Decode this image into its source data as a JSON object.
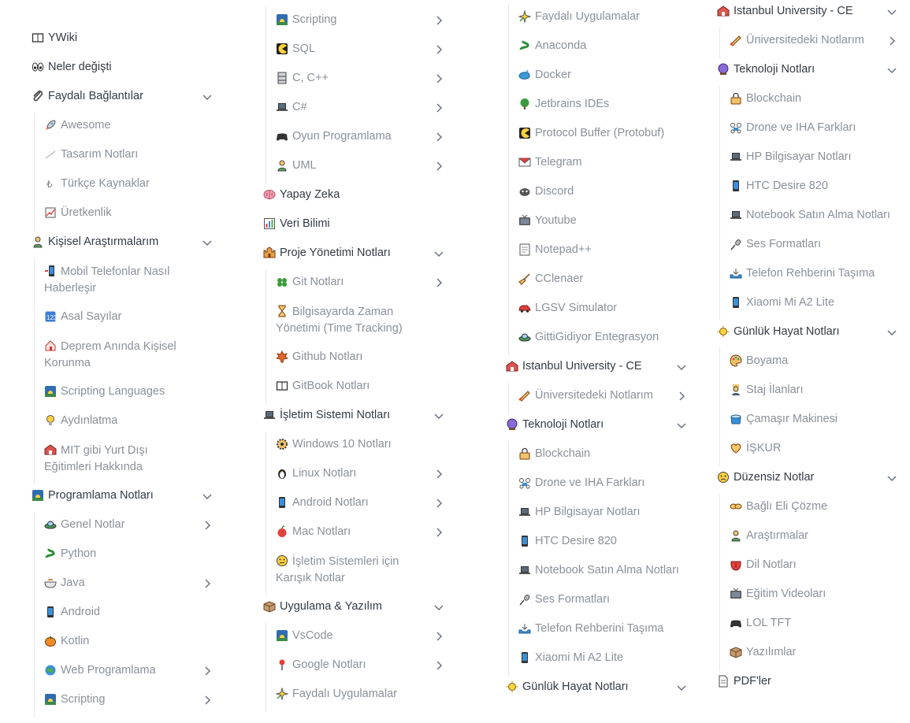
{
  "columns": [
    {
      "items": [
        {
          "label": "YWiki",
          "icon": "book-icon",
          "level": 0
        },
        {
          "label": "Neler değişti",
          "icon": "eyes-icon",
          "level": 0
        },
        {
          "label": "Faydalı Bağlantılar",
          "icon": "paperclip-icon",
          "level": 0,
          "expanded": true
        },
        {
          "label": "Awesome",
          "icon": "rocket-icon",
          "level": 1
        },
        {
          "label": "Tasarım Notları",
          "icon": "pencil-line-icon",
          "level": 1
        },
        {
          "label": "Türkçe Kaynaklar",
          "icon": "turkish-lira-icon",
          "level": 1
        },
        {
          "label": "Üretkenlik",
          "icon": "chart-increasing-icon",
          "level": 1
        },
        {
          "label": "Kişisel Araştırmalarım",
          "icon": "person-icon",
          "level": 0,
          "expanded": true
        },
        {
          "label": "Mobil Telefonlar Nasıl Haberleşir",
          "icon": "mobile-arrow-icon",
          "level": 1,
          "wrap": true
        },
        {
          "label": "Asal Sayılar",
          "icon": "numbers-icon",
          "level": 1
        },
        {
          "label": "Deprem Anında Kişisel Korunma",
          "icon": "house-icon",
          "level": 1,
          "wrap": true
        },
        {
          "label": "Scripting Languages",
          "icon": "sunrise-icon",
          "level": 1
        },
        {
          "label": "Aydınlatma",
          "icon": "lightbulb-icon",
          "level": 1
        },
        {
          "label": "MIT gibi Yurt Dışı Eğitimleri Hakkında",
          "icon": "school-icon",
          "level": 1,
          "wrap": true
        },
        {
          "label": "Programlama Notları",
          "icon": "sunrise-icon",
          "level": 0,
          "expanded": true
        },
        {
          "label": "Genel Notlar",
          "icon": "flying-saucer-icon",
          "level": 1,
          "has_children": true
        },
        {
          "label": "Python",
          "icon": "snake-icon",
          "level": 1
        },
        {
          "label": "Java",
          "icon": "bowl-icon",
          "level": 1,
          "has_children": true
        },
        {
          "label": "Android",
          "icon": "mobile-icon",
          "level": 1
        },
        {
          "label": "Kotlin",
          "icon": "pumpkin-icon",
          "level": 1
        },
        {
          "label": "Web Programlama",
          "icon": "globe-icon",
          "level": 1,
          "has_children": true
        },
        {
          "label": "Scripting",
          "icon": "sunrise-icon",
          "level": 1,
          "has_children": true
        }
      ]
    },
    {
      "items": [
        {
          "label": "Scripting",
          "icon": "sunrise-icon",
          "level": 1,
          "has_children": true
        },
        {
          "label": "SQL",
          "icon": "pacman-icon",
          "level": 1,
          "has_children": true
        },
        {
          "label": "C, C++",
          "icon": "file-cabinet-icon",
          "level": 1,
          "has_children": true
        },
        {
          "label": "C#",
          "icon": "laptop-icon",
          "level": 1,
          "has_children": true
        },
        {
          "label": "Oyun Programlama",
          "icon": "gamepad-icon",
          "level": 1,
          "has_children": true
        },
        {
          "label": "UML",
          "icon": "person-icon",
          "level": 1,
          "has_children": true
        },
        {
          "label": "Yapay Zeka",
          "icon": "brain-icon",
          "level": 0
        },
        {
          "label": "Veri Bilimi",
          "icon": "bar-chart-icon",
          "level": 0
        },
        {
          "label": "Proje Yönetimi Notları",
          "icon": "castle-icon",
          "level": 0,
          "expanded": true
        },
        {
          "label": "Git Notları",
          "icon": "clover-icon",
          "level": 1,
          "has_children": true
        },
        {
          "label": "Bilgisayarda Zaman Yönetimi (Time Tracking)",
          "icon": "hourglass-icon",
          "level": 1,
          "wrap": true
        },
        {
          "label": "Github Notları",
          "icon": "maple-leaf-icon",
          "level": 1
        },
        {
          "label": "GitBook Notları",
          "icon": "book-icon",
          "level": 1
        },
        {
          "label": "İşletim Sistemi Notları",
          "icon": "laptop-icon",
          "level": 0,
          "expanded": true
        },
        {
          "label": "Windows 10 Notları",
          "icon": "gear-icon",
          "level": 1
        },
        {
          "label": "Linux Notları",
          "icon": "penguin-icon",
          "level": 1,
          "has_children": true
        },
        {
          "label": "Android Notları",
          "icon": "mobile-icon",
          "level": 1,
          "has_children": true
        },
        {
          "label": "Mac Notları",
          "icon": "apple-icon",
          "level": 1,
          "has_children": true
        },
        {
          "label": "İşletim Sistemleri için Karışık Notlar",
          "icon": "confused-face-icon",
          "level": 1,
          "wrap": true
        },
        {
          "label": "Uygulama & Yazılım",
          "icon": "package-icon",
          "level": 0,
          "expanded": true
        },
        {
          "label": "VsCode",
          "icon": "sunrise-icon",
          "level": 1,
          "has_children": true
        },
        {
          "label": "Google Notları",
          "icon": "pin-icon",
          "level": 1,
          "has_children": true
        },
        {
          "label": "Faydalı Uygulamalar",
          "icon": "sparkle-star-icon",
          "level": 1
        }
      ]
    },
    {
      "items": [
        {
          "label": "Faydalı Uygulamalar",
          "icon": "sparkle-star-icon",
          "level": 1
        },
        {
          "label": "Anaconda",
          "icon": "snake-icon",
          "level": 1
        },
        {
          "label": "Docker",
          "icon": "whale-icon",
          "level": 1
        },
        {
          "label": "Jetbrains IDEs",
          "icon": "tree-icon",
          "level": 1
        },
        {
          "label": "Protocol Buffer (Protobuf)",
          "icon": "pacman-icon",
          "level": 1
        },
        {
          "label": "Telegram",
          "icon": "envelope-icon",
          "level": 1
        },
        {
          "label": "Discord",
          "icon": "gamepad-round-icon",
          "level": 1
        },
        {
          "label": "Youtube",
          "icon": "tv-icon",
          "level": 1
        },
        {
          "label": "Notepad++",
          "icon": "note-icon",
          "level": 1
        },
        {
          "label": "CClenaer",
          "icon": "broom-icon",
          "level": 1
        },
        {
          "label": "LGSV Simulator",
          "icon": "car-icon",
          "level": 1
        },
        {
          "label": "GittiGidiyor Entegrasyon",
          "icon": "flying-saucer-icon",
          "level": 1
        },
        {
          "label": "Istanbul University - CE",
          "icon": "school-icon",
          "level": 0,
          "expanded": true
        },
        {
          "label": "Üniversitedeki Notlarım",
          "icon": "writing-hand-icon",
          "level": 1,
          "has_children": true
        },
        {
          "label": "Teknoloji Notları",
          "icon": "crystal-ball-icon",
          "level": 0,
          "expanded": true
        },
        {
          "label": "Blockchain",
          "icon": "lock-icon",
          "level": 1
        },
        {
          "label": "Drone ve IHA Farkları",
          "icon": "drone-icon",
          "level": 1
        },
        {
          "label": "HP Bilgisayar Notları",
          "icon": "laptop-icon",
          "level": 1
        },
        {
          "label": "HTC Desire 820",
          "icon": "mobile-icon",
          "level": 1
        },
        {
          "label": "Notebook Satın Alma Notları",
          "icon": "laptop-icon",
          "level": 1
        },
        {
          "label": "Ses Formatları",
          "icon": "microphone-icon",
          "level": 1
        },
        {
          "label": "Telefon Rehberini Taşıma",
          "icon": "inbox-icon",
          "level": 1
        },
        {
          "label": "Xiaomi Mi A2 Lite",
          "icon": "mobile-icon",
          "level": 1
        },
        {
          "label": "Günlük Hayat Notları",
          "icon": "sun-icon",
          "level": 0,
          "expanded": true
        }
      ]
    },
    {
      "items": [
        {
          "label": "Istanbul University - CE",
          "icon": "school-icon",
          "level": 0,
          "expanded": true
        },
        {
          "label": "Üniversitedeki Notlarım",
          "icon": "writing-hand-icon",
          "level": 1,
          "has_children": true
        },
        {
          "label": "Teknoloji Notları",
          "icon": "crystal-ball-icon",
          "level": 0,
          "expanded": true
        },
        {
          "label": "Blockchain",
          "icon": "lock-icon",
          "level": 1
        },
        {
          "label": "Drone ve IHA Farkları",
          "icon": "drone-icon",
          "level": 1
        },
        {
          "label": "HP Bilgisayar Notları",
          "icon": "laptop-icon",
          "level": 1
        },
        {
          "label": "HTC Desire 820",
          "icon": "mobile-icon",
          "level": 1
        },
        {
          "label": "Notebook Satın Alma Notları",
          "icon": "laptop-icon",
          "level": 1
        },
        {
          "label": "Ses Formatları",
          "icon": "microphone-icon",
          "level": 1
        },
        {
          "label": "Telefon Rehberini Taşıma",
          "icon": "inbox-icon",
          "level": 1
        },
        {
          "label": "Xiaomi Mi A2 Lite",
          "icon": "mobile-icon",
          "level": 1
        },
        {
          "label": "Günlük Hayat Notları",
          "icon": "sun-icon",
          "level": 0,
          "expanded": true
        },
        {
          "label": "Boyama",
          "icon": "palette-icon",
          "level": 1
        },
        {
          "label": "Staj İlanları",
          "icon": "worker-icon",
          "level": 1
        },
        {
          "label": "Çamaşır Makinesi",
          "icon": "washer-icon",
          "level": 1
        },
        {
          "label": "İŞKUR",
          "icon": "heart-hands-icon",
          "level": 1
        },
        {
          "label": "Düzensiz Notlar",
          "icon": "frown-face-icon",
          "level": 0,
          "expanded": true
        },
        {
          "label": "Bağlı Eli Çözme",
          "icon": "handshake-icon",
          "level": 1
        },
        {
          "label": "Araştırmalar",
          "icon": "person-icon",
          "level": 1
        },
        {
          "label": "Dil Notları",
          "icon": "tongue-icon",
          "level": 1
        },
        {
          "label": "Eğitim Videoları",
          "icon": "tv-icon",
          "level": 1
        },
        {
          "label": "LOL TFT",
          "icon": "gamepad-icon",
          "level": 1
        },
        {
          "label": "Yazılımlar",
          "icon": "package-icon",
          "level": 1
        },
        {
          "label": "PDF'ler",
          "icon": "document-icon",
          "level": 0
        }
      ]
    }
  ]
}
